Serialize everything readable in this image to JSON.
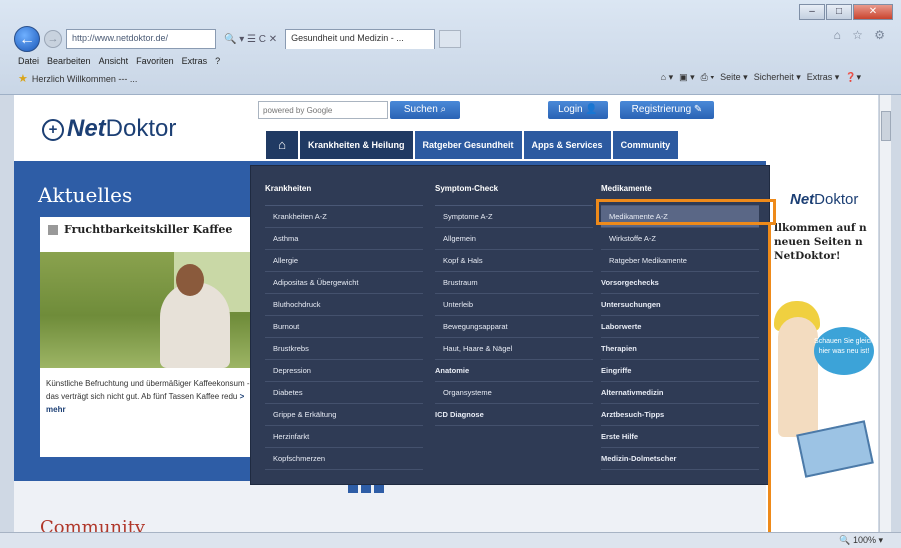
{
  "browser": {
    "address": "http://www.netdoktor.de/",
    "address_tools": "🔍 ▾ ☰ C ✕",
    "tab_title": "Gesundheit und Medizin - ...",
    "menu": [
      "Datei",
      "Bearbeiten",
      "Ansicht",
      "Favoriten",
      "Extras",
      "?"
    ],
    "favorite": "Herzlich Willkommen --- ...",
    "commands": [
      "Seite ▾",
      "Sicherheit ▾",
      "Extras ▾"
    ],
    "zoom": "100%"
  },
  "site": {
    "logo_net": "Net",
    "logo_rest": "Doktor",
    "search_placeholder": "powered by Google",
    "search_button": "Suchen",
    "login": "Login",
    "register": "Registrierung",
    "nav": [
      "Krankheiten & Heilung",
      "Ratgeber Gesundheit",
      "Apps & Services",
      "Community"
    ]
  },
  "main": {
    "heading": "Aktuelles",
    "card_title": "Fruchtbarkeitskiller Kaffee",
    "card_text": "Künstliche Befruchtung und übermäßiger Kaffeekonsum - das verträgt sich nicht gut. Ab fünf Tassen Kaffee redu",
    "more": "> mehr",
    "community_heading": "Community"
  },
  "megamenu": {
    "col1": {
      "header": "Krankheiten",
      "items": [
        "Krankheiten A-Z",
        "Asthma",
        "Allergie",
        "Adipositas & Übergewicht",
        "Bluthochdruck",
        "Burnout",
        "Brustkrebs",
        "Depression",
        "Diabetes",
        "Grippe & Erkältung",
        "Herzinfarkt",
        "Kopfschmerzen"
      ]
    },
    "col2": {
      "header": "Symptom-Check",
      "items": [
        "Symptome A-Z",
        "Allgemein",
        "Kopf & Hals",
        "Brustraum",
        "Unterleib",
        "Bewegungsapparat",
        "Haut, Haare & Nägel"
      ],
      "header2": "Anatomie",
      "items2": [
        "Organsysteme"
      ],
      "header3": "ICD Diagnose"
    },
    "col3": {
      "header": "Medikamente",
      "items": [
        "Medikamente A-Z",
        "Wirkstoffe A-Z",
        "Ratgeber Medikamente"
      ],
      "sections": [
        "Vorsorgechecks",
        "Untersuchungen",
        "Laborwerte",
        "Therapien",
        "Eingriffe",
        "Alternativmedizin",
        "Arztbesuch-Tipps",
        "Erste Hilfe",
        "Medizin-Dolmetscher"
      ]
    }
  },
  "sidebar": {
    "logo_net": "Net",
    "logo_rest": "Doktor",
    "welcome": "llkommen auf n neuen Seiten n NetDoktor!",
    "bubble": "Schauen Sie gleich hier was neu ist!"
  }
}
